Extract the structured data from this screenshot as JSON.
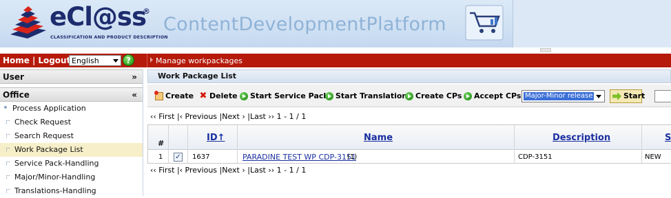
{
  "banner": {
    "brand": "eCl@ss",
    "registered": "®",
    "tagline": "CLASSIFICATION AND PRODUCT DESCRIPTION",
    "platform": "ContentDevelopmentPlatform"
  },
  "topnav": {
    "home": "Home",
    "logout": "Logout",
    "separator": "|",
    "language": "English",
    "help": "?",
    "breadcrumb": "Manage workpackages"
  },
  "sidebar": {
    "user_title": "User",
    "user_chevron": "»",
    "office_title": "Office",
    "office_chevron": "«",
    "items": [
      {
        "label": "Process Application"
      },
      {
        "label": "Check Request"
      },
      {
        "label": "Search Request"
      },
      {
        "label": "Work Package List"
      },
      {
        "label": "Service Pack-Handling"
      },
      {
        "label": "Major/Minor-Handling"
      },
      {
        "label": "Translations-Handling"
      }
    ]
  },
  "main": {
    "title": "Work Package List",
    "toolbar": {
      "create": "Create",
      "delete": "Delete",
      "start_service_pack": "Start Service Pack",
      "start_translations": "Start Translations",
      "create_cps": "Create CPs",
      "accept_cps": "Accept CPs",
      "release_select": "Major-Minor release",
      "start": "Start"
    },
    "pager": "‹‹ First |‹ Previous |Next › |Last ›› 1 - 1 / 1",
    "columns": {
      "hash": "#",
      "id": "ID↑",
      "name": "Name",
      "description": "Description",
      "status": "S"
    },
    "rows": [
      {
        "num": "1",
        "checked": "✓",
        "id": "1637",
        "name": "PARADINE TEST WP CDP-3151",
        "count": "(1)",
        "description": "CDP-3151",
        "status": "NEW"
      }
    ]
  },
  "colors": {
    "redbar": "#b51a0b",
    "link": "#1a2fa0",
    "active_item": "#f7efc9"
  }
}
